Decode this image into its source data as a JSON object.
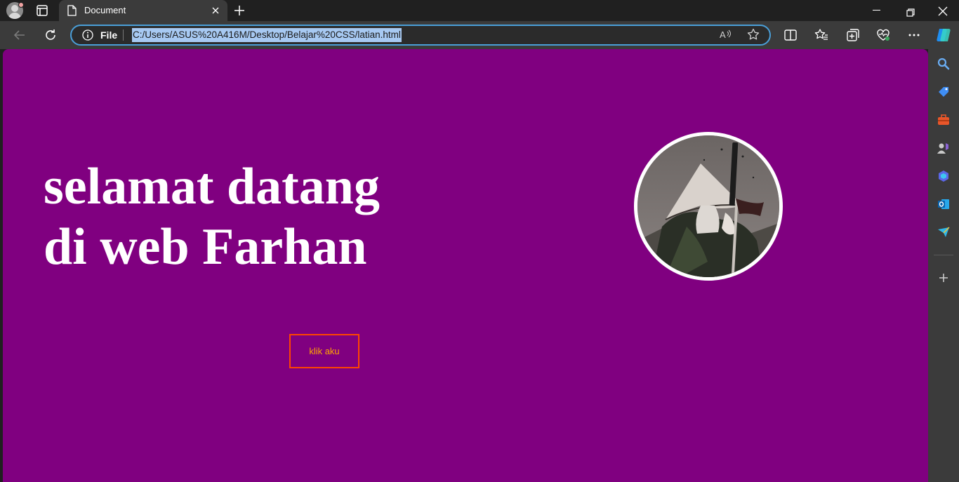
{
  "browser": {
    "tab": {
      "title": "Document"
    },
    "address": {
      "scheme_label": "File",
      "url": "C:/Users/ASUS%20A416M/Desktop/Belajar%20CSS/latian.html"
    },
    "accent": "#4a9fd8"
  },
  "page": {
    "background": "#800080",
    "heading_line1": "selamat datang",
    "heading_line2_prefix": "di ",
    "heading_line2_bold": "web Farhan",
    "button_label": "klik aku",
    "button_border_color": "#ff4500",
    "button_text_color": "#ffa500",
    "avatar_alt": "samurai-illustration"
  },
  "sidebar": {
    "icons": [
      "search-icon",
      "tag-icon",
      "toolbox-icon",
      "games-icon",
      "copilot-icon",
      "outlook-icon",
      "send-icon",
      "add-icon"
    ]
  }
}
